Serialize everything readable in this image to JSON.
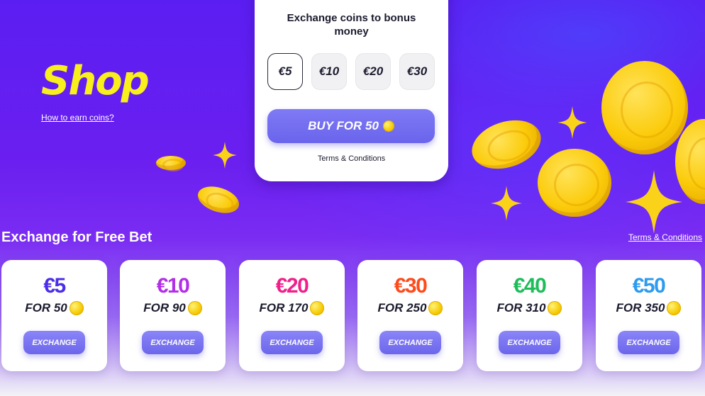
{
  "header": {
    "title": "Shop",
    "how_link": "How to earn coins?"
  },
  "exchange_card": {
    "title": "Exchange coins to bonus money",
    "amounts": [
      "€5",
      "€10",
      "€20",
      "€30"
    ],
    "selected_amount": "€5",
    "buy_label": "BUY FOR 50",
    "terms": "Terms & Conditions"
  },
  "section": {
    "title": "Exchange for Free Bet",
    "terms": "Terms & Conditions"
  },
  "offers": [
    {
      "value": "€5",
      "price": "FOR 50",
      "button": "EXCHANGE",
      "color": "#4a2ee8"
    },
    {
      "value": "€10",
      "price": "FOR 90",
      "button": "EXCHANGE",
      "color": "#b42ee8"
    },
    {
      "value": "€20",
      "price": "FOR 170",
      "button": "EXCHANGE",
      "color": "#f0208a"
    },
    {
      "value": "€30",
      "price": "FOR 250",
      "button": "EXCHANGE",
      "color": "#ff4a1a"
    },
    {
      "value": "€40",
      "price": "FOR 310",
      "button": "EXCHANGE",
      "color": "#1dbd5a"
    },
    {
      "value": "€50",
      "price": "FOR 350",
      "button": "EXCHANGE",
      "color": "#2d9bf0"
    }
  ],
  "icons": {
    "coin": "coin-icon",
    "sparkle": "sparkle-icon"
  },
  "colors": {
    "brand_yellow": "#f9ef1c",
    "button": "#6a64ec",
    "hero": "#5b1ef2"
  }
}
